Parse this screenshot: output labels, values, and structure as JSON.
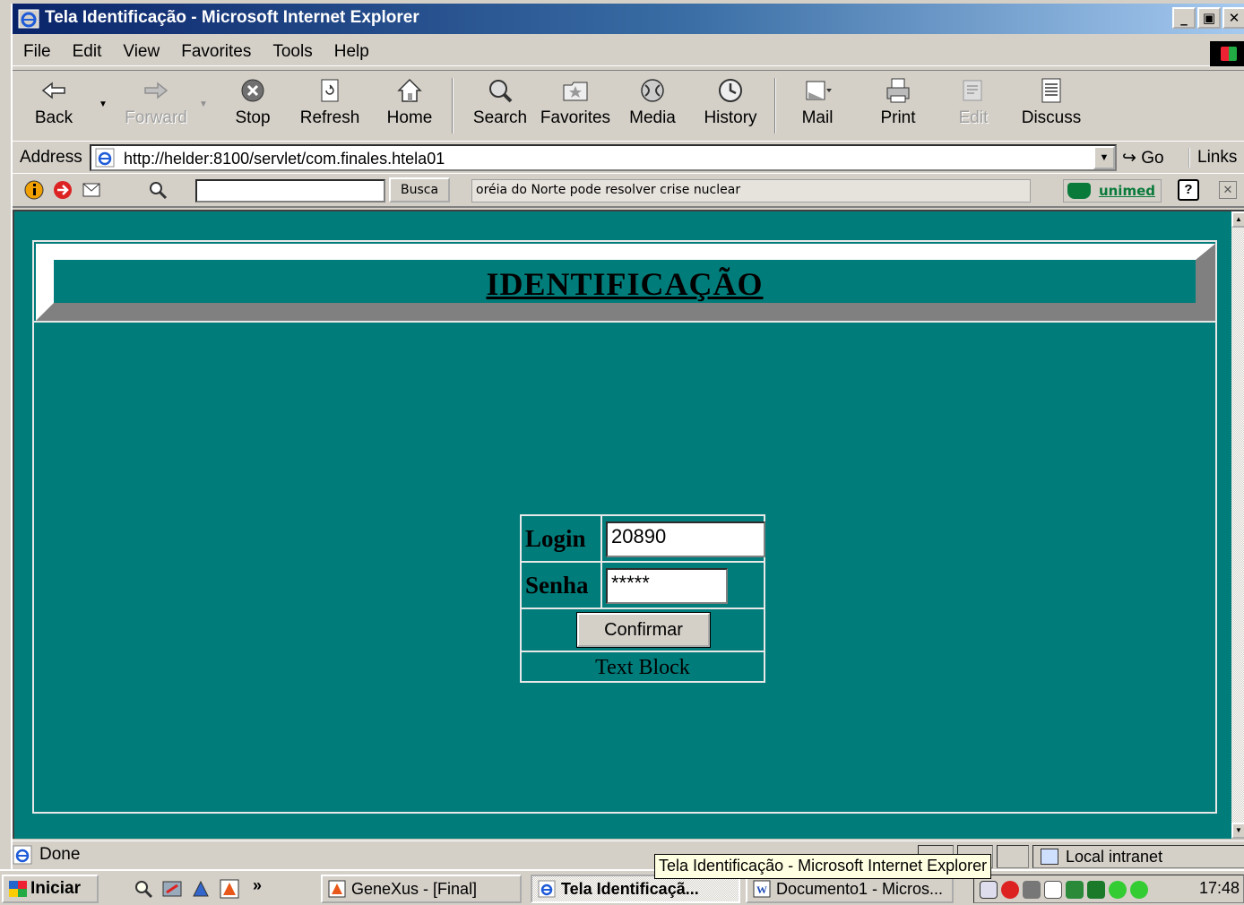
{
  "window": {
    "title": "Tela Identificação - Microsoft Internet Explorer",
    "buttons": {
      "minimize": "_",
      "maximize": "▣",
      "close": "✕"
    }
  },
  "menu": [
    "File",
    "Edit",
    "View",
    "Favorites",
    "Tools",
    "Help"
  ],
  "toolbar": {
    "back": "Back",
    "forward": "Forward",
    "stop": "Stop",
    "refresh": "Refresh",
    "home": "Home",
    "search": "Search",
    "favorites": "Favorites",
    "media": "Media",
    "history": "History",
    "mail": "Mail",
    "print": "Print",
    "edit": "Edit",
    "discuss": "Discuss"
  },
  "address": {
    "label": "Address",
    "url": "http://helder:8100/servlet/com.finales.htela01",
    "go": "Go",
    "links": "Links"
  },
  "custom_toolbar": {
    "search_button": "Busca",
    "news_ticker": "oréia do Norte pode resolver crise nuclear",
    "brand": "unimed"
  },
  "page": {
    "heading": "IDENTIFICAÇÃO",
    "login_label": "Login",
    "login_value": "20890",
    "password_label": "Senha",
    "password_value": "*****",
    "confirm_button": "Confirmar",
    "text_block": "Text Block"
  },
  "status": {
    "text": "Done",
    "zone": "Local intranet",
    "tooltip": "Tela Identificação - Microsoft Internet Explorer"
  },
  "taskbar": {
    "start": "Iniciar",
    "more": "»",
    "tasks": [
      {
        "label": "GeneXus - [Final]",
        "active": false
      },
      {
        "label": "Tela Identificaçã...",
        "active": true
      },
      {
        "label": "Documento1 - Micros...",
        "active": false
      }
    ],
    "clock": "17:48"
  },
  "colors": {
    "page_background": "#007c7a",
    "titlebar_start": "#0a246a",
    "titlebar_end": "#a6caf0",
    "window_chrome": "#d4d0c8"
  }
}
